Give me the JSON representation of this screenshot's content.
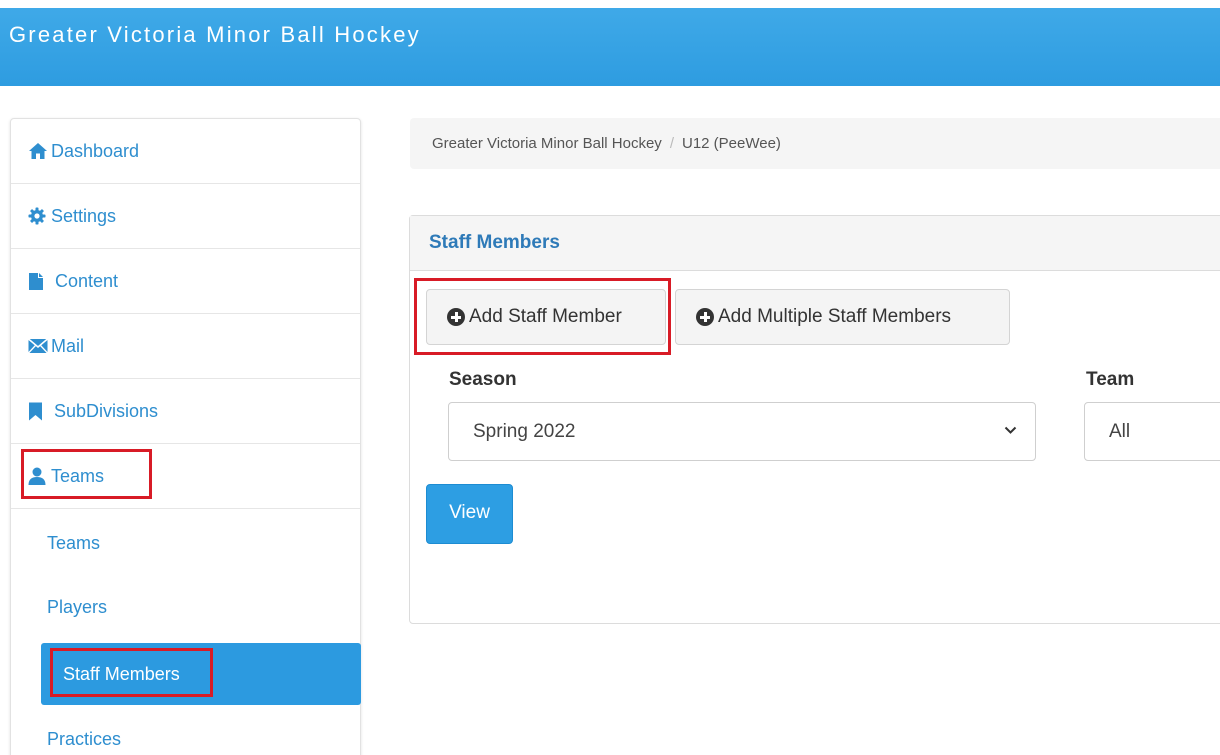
{
  "header": {
    "title": "Greater Victoria Minor Ball Hockey"
  },
  "sidebar": {
    "items": [
      {
        "label": "Dashboard",
        "icon": "home-icon"
      },
      {
        "label": "Settings",
        "icon": "gear-icon"
      },
      {
        "label": "Content",
        "icon": "file-icon"
      },
      {
        "label": "Mail",
        "icon": "envelope-icon"
      },
      {
        "label": "SubDivisions",
        "icon": "bookmark-icon"
      },
      {
        "label": "Teams",
        "icon": "user-icon"
      }
    ],
    "subitems": [
      {
        "label": "Teams"
      },
      {
        "label": "Players"
      },
      {
        "label": "Staff Members",
        "active": true
      },
      {
        "label": "Practices"
      }
    ]
  },
  "breadcrumb": {
    "items": [
      "Greater Victoria Minor Ball Hockey",
      "U12 (PeeWee)"
    ],
    "separator": "/"
  },
  "panel": {
    "title": "Staff Members",
    "add_button": "Add Staff Member",
    "add_multiple_button": "Add Multiple Staff Members",
    "season": {
      "label": "Season",
      "value": "Spring 2022"
    },
    "team": {
      "label": "Team",
      "value": "All"
    },
    "view_button": "View"
  },
  "colors": {
    "header_bg": "#3fa9e8",
    "link": "#2e8ecf",
    "active_bg": "#2c9ae0",
    "highlight": "#d81b26",
    "primary_button": "#2d9ee3"
  }
}
